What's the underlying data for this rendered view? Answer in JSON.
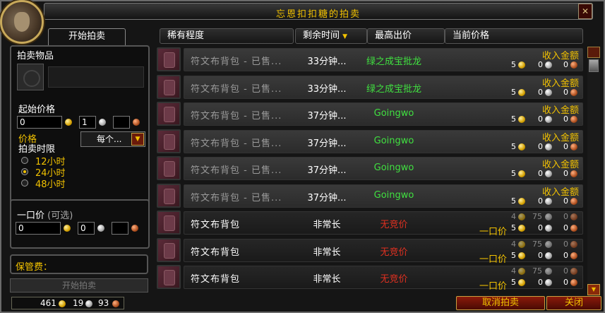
{
  "window": {
    "title": "忘恩扣扣糖的拍卖",
    "close_glyph": "✕"
  },
  "left": {
    "tab_label": "开始拍卖",
    "auction_item_label": "拍卖物品",
    "start_price_label": "起始价格",
    "start_price": {
      "gold": "0",
      "silver": "1",
      "copper": ""
    },
    "price_label": "价格",
    "per_item": "每个...",
    "duration_label": "拍卖时限",
    "durations": [
      "12小时",
      "24小时",
      "48小时"
    ],
    "selected_duration": 1,
    "buyout_label": "一口价",
    "buyout_optional": "(可选)",
    "buyout_price": {
      "gold": "0",
      "silver": "0",
      "copper": ""
    },
    "deposit_label": "保管费：",
    "start_button": "开始拍卖"
  },
  "money": {
    "gold": "461",
    "silver": "19",
    "copper": "93"
  },
  "headers": {
    "rarity": "稀有程度",
    "time_left": "剩余时间",
    "sort_icon": "▼",
    "top_bidder": "最高出价",
    "current_price": "当前价格"
  },
  "rows": [
    {
      "name": "符文布背包 - 已售...",
      "time": "33分钟...",
      "bidder": "绿之成宝批龙",
      "bidder_color": "#40e040",
      "label": "收入金额",
      "gold": "5",
      "silver": "0",
      "copper": "0",
      "sold": true
    },
    {
      "name": "符文布背包 - 已售...",
      "time": "33分钟...",
      "bidder": "绿之成宝批龙",
      "bidder_color": "#40e040",
      "label": "收入金额",
      "gold": "5",
      "silver": "0",
      "copper": "0",
      "sold": true
    },
    {
      "name": "符文布背包 - 已售...",
      "time": "37分钟...",
      "bidder": "Goingwo",
      "bidder_color": "#40e040",
      "label": "收入金额",
      "gold": "5",
      "silver": "0",
      "copper": "0",
      "sold": true
    },
    {
      "name": "符文布背包 - 已售...",
      "time": "37分钟...",
      "bidder": "Goingwo",
      "bidder_color": "#40e040",
      "label": "收入金额",
      "gold": "5",
      "silver": "0",
      "copper": "0",
      "sold": true
    },
    {
      "name": "符文布背包 - 已售...",
      "time": "37分钟...",
      "bidder": "Goingwo",
      "bidder_color": "#40e040",
      "label": "收入金额",
      "gold": "5",
      "silver": "0",
      "copper": "0",
      "sold": true
    },
    {
      "name": "符文布背包 - 已售...",
      "time": "37分钟...",
      "bidder": "Goingwo",
      "bidder_color": "#40e040",
      "label": "收入金额",
      "gold": "5",
      "silver": "0",
      "copper": "0",
      "sold": true
    },
    {
      "name": "符文布背包",
      "time": "非常长",
      "bidder": "无竞价",
      "bidder_color": "#e03020",
      "label": "一口价",
      "bid_gold": "4",
      "bid_silver": "75",
      "bid_copper": "0",
      "gold": "5",
      "silver": "0",
      "copper": "0",
      "sold": false
    },
    {
      "name": "符文布背包",
      "time": "非常长",
      "bidder": "无竞价",
      "bidder_color": "#e03020",
      "label": "一口价",
      "bid_gold": "4",
      "bid_silver": "75",
      "bid_copper": "0",
      "gold": "5",
      "silver": "0",
      "copper": "0",
      "sold": false
    },
    {
      "name": "符文布背包",
      "time": "非常长",
      "bidder": "无竞价",
      "bidder_color": "#e03020",
      "label": "一口价",
      "bid_gold": "4",
      "bid_silver": "75",
      "bid_copper": "0",
      "gold": "5",
      "silver": "0",
      "copper": "0",
      "sold": false
    }
  ],
  "buttons": {
    "cancel": "取消拍卖",
    "close": "关闭"
  },
  "colors": {
    "gold_text": "#f2c200",
    "green_bidder": "#40e040",
    "red_bidder": "#e03020"
  }
}
